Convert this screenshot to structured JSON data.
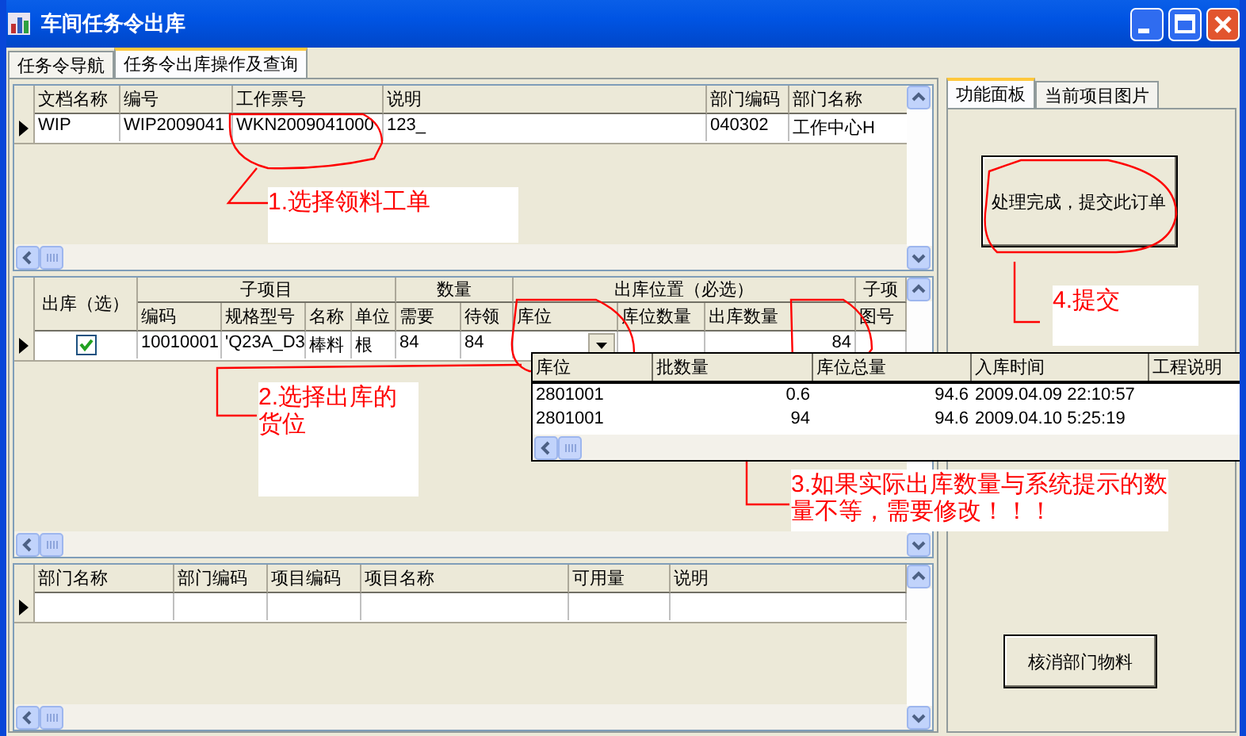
{
  "window": {
    "title": "车间任务令出库"
  },
  "tabs": [
    {
      "label": "任务令导航",
      "selected": false
    },
    {
      "label": "任务令出库操作及查询",
      "selected": true
    }
  ],
  "orders_grid": {
    "columns": [
      "文档名称",
      "编号",
      "工作票号",
      "说明",
      "部门编码",
      "部门名称"
    ],
    "rows": [
      {
        "selected": true,
        "cells": [
          "WIP",
          "WIP2009041",
          "WKN2009041000",
          "123_",
          "040302",
          "工作中心H"
        ]
      }
    ]
  },
  "items_grid": {
    "column_groups": [
      {
        "label": "出库（选）"
      },
      {
        "label": "子项目",
        "columns": [
          "编码",
          "规格型号",
          "名称",
          "单位"
        ]
      },
      {
        "label": "数量",
        "columns": [
          "需要",
          "待领"
        ]
      },
      {
        "label": "出库位置（必选）",
        "columns": [
          "库位",
          "库位数量",
          "出库数量"
        ]
      },
      {
        "label": "子项",
        "columns": [
          "图号"
        ]
      }
    ],
    "rows": [
      {
        "selected": true,
        "checked": true,
        "cells": [
          {
            "kind": "text",
            "text": "10010001"
          },
          {
            "kind": "text",
            "text": "'Q23A_D3"
          },
          {
            "kind": "text",
            "text": "棒料"
          },
          {
            "kind": "text",
            "text": "根"
          },
          {
            "kind": "text",
            "text": "84"
          },
          {
            "kind": "text",
            "text": "84"
          },
          {
            "kind": "combo"
          },
          {
            "kind": "blank"
          },
          {
            "kind": "number",
            "text": "84"
          },
          {
            "kind": "blank"
          }
        ]
      }
    ]
  },
  "location_popup": {
    "columns": [
      "库位",
      "批数量",
      "库位总量",
      "入库时间",
      "工程说明"
    ],
    "rows": [
      [
        "2801001",
        "0.6",
        "94.6",
        "2009.04.09 22:10:57"
      ],
      [
        "2801001",
        "94",
        "94.6",
        "2009.04.10 5:25:19"
      ]
    ]
  },
  "dept_grid": {
    "columns": [
      "部门名称",
      "部门编码",
      "项目编码",
      "项目名称",
      "可用量",
      "说明"
    ],
    "rows": [
      {
        "selected": true
      }
    ]
  },
  "side_panel": {
    "tabs": [
      {
        "label": "功能面板",
        "selected": true
      },
      {
        "label": "当前项目图片",
        "selected": false
      }
    ],
    "buttons": [
      "处理完成，提交此订单",
      "核消部门物料"
    ]
  },
  "annotations": [
    {
      "text": "1.选择领料工单"
    },
    {
      "text": "2.选择出库的货位"
    },
    {
      "text": "3.如果实际出库数量与系统提示的数量不等，需要修改！！！"
    },
    {
      "text": "4.提交"
    }
  ]
}
